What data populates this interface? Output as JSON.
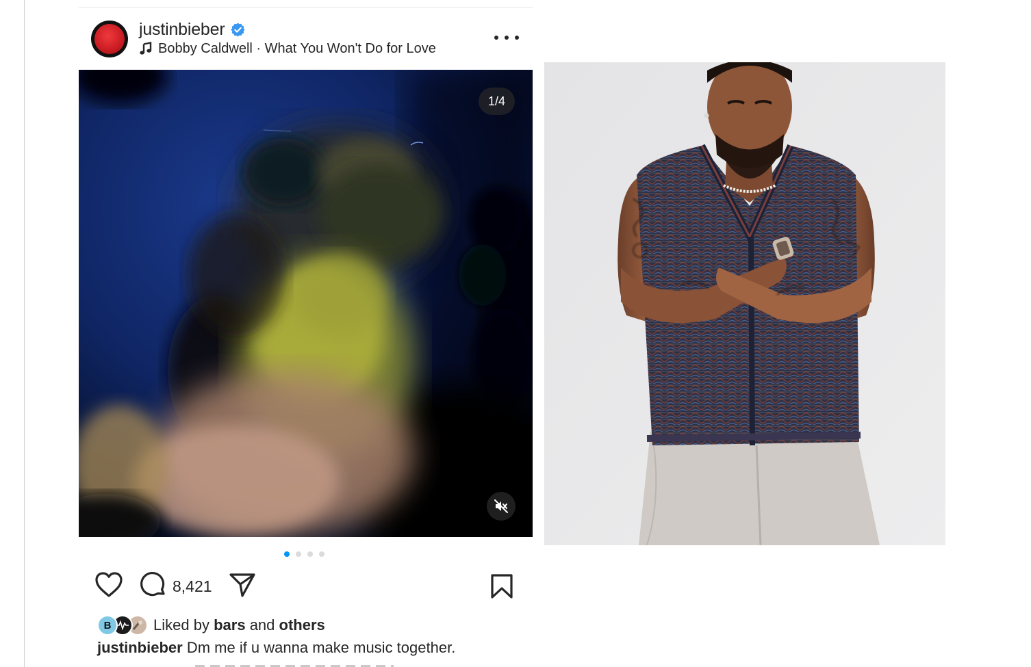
{
  "post": {
    "username": "justinbieber",
    "verified": true,
    "audio": "Bobby Caldwell · What You Won't Do for Love",
    "media_counter": "1/4",
    "carousel_total": 4,
    "carousel_active_index": 1,
    "sound": "muted",
    "comment_count": "8,421",
    "liked_by_prefix": "Liked by",
    "liked_by_user": "bars",
    "liked_by_joiner": "and",
    "liked_by_suffix": "others",
    "liker_initials": [
      "B"
    ],
    "caption_user": "justinbieber",
    "caption_text": "Dm me if u wanna make music together."
  },
  "icons": {
    "verified": "verified-badge-icon",
    "audio": "music-note-icon",
    "more": "more-options-icon",
    "mute": "muted-speaker-icon",
    "like": "heart-icon",
    "comment": "comment-icon",
    "share": "share-icon",
    "save": "bookmark-icon"
  },
  "colors": {
    "text": "#262626",
    "verified_blue": "#3897f0",
    "dot_active": "#0095f6",
    "dot_inactive": "#dbdbdb",
    "avatar_red": "#cc1e24"
  }
}
